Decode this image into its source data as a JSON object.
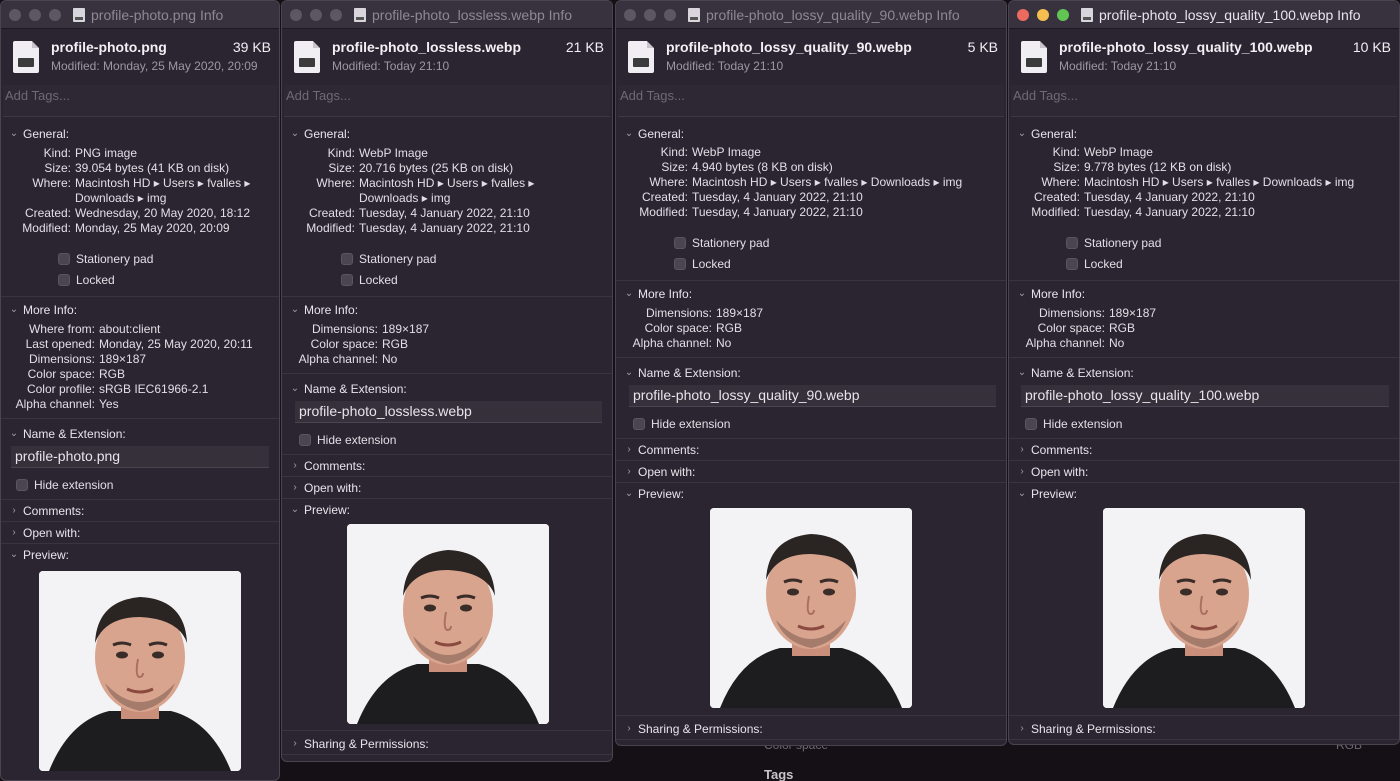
{
  "desktop": {
    "bg_text": "Color space",
    "bg_value": "RGB",
    "bg_label": "Tags"
  },
  "windows": [
    {
      "title": "profile-photo.png Info",
      "filename": "profile-photo.png",
      "size_short": "39 KB",
      "modified": "Modified: Monday, 25 May 2020, 20:09",
      "tags_placeholder": "Add Tags...",
      "general_label": "General:",
      "kind_key": "Kind:",
      "kind": "PNG image",
      "size_key": "Size:",
      "size": "39.054 bytes (41 KB on disk)",
      "where_key": "Where:",
      "where": "Macintosh HD ▸ Users ▸ fvalles ▸",
      "where2": "Downloads ▸ img",
      "created_key": "Created:",
      "created": "Wednesday, 20 May 2020, 18:12",
      "modified_key": "Modified:",
      "modified_val": "Monday, 25 May 2020, 20:09",
      "stationery": "Stationery pad",
      "locked": "Locked",
      "more_info_label": "More Info:",
      "more_info": [
        {
          "k": "Where from:",
          "v": "about:client"
        },
        {
          "k": "Last opened:",
          "v": "Monday, 25 May 2020, 20:11"
        },
        {
          "k": "Dimensions:",
          "v": "189×187"
        },
        {
          "k": "Color space:",
          "v": "RGB"
        },
        {
          "k": "Color profile:",
          "v": "sRGB IEC61966-2.1"
        },
        {
          "k": "Alpha channel:",
          "v": "Yes"
        }
      ],
      "name_ext_label": "Name & Extension:",
      "name_value": "profile-photo.png",
      "hide_ext": "Hide extension",
      "comments_label": "Comments:",
      "open_with_label": "Open with:",
      "preview_label": "Preview:"
    },
    {
      "title": "profile-photo_lossless.webp Info",
      "filename": "profile-photo_lossless.webp",
      "size_short": "21 KB",
      "modified": "Modified: Today 21:10",
      "tags_placeholder": "Add Tags...",
      "general_label": "General:",
      "kind_key": "Kind:",
      "kind": "WebP Image",
      "size_key": "Size:",
      "size": "20.716 bytes (25 KB on disk)",
      "where_key": "Where:",
      "where": "Macintosh HD ▸ Users ▸ fvalles ▸",
      "where2": "Downloads ▸ img",
      "created_key": "Created:",
      "created": "Tuesday, 4 January 2022, 21:10",
      "modified_key": "Modified:",
      "modified_val": "Tuesday, 4 January 2022, 21:10",
      "stationery": "Stationery pad",
      "locked": "Locked",
      "more_info_label": "More Info:",
      "more_info": [
        {
          "k": "Dimensions:",
          "v": "189×187"
        },
        {
          "k": "Color space:",
          "v": "RGB"
        },
        {
          "k": "Alpha channel:",
          "v": "No"
        }
      ],
      "name_ext_label": "Name & Extension:",
      "name_value": "profile-photo_lossless.webp",
      "hide_ext": "Hide extension",
      "comments_label": "Comments:",
      "open_with_label": "Open with:",
      "preview_label": "Preview:",
      "sharing_label": "Sharing & Permissions:"
    },
    {
      "title": "profile-photo_lossy_quality_90.webp Info",
      "filename": "profile-photo_lossy_quality_90.webp",
      "size_short": "5 KB",
      "modified": "Modified: Today 21:10",
      "tags_placeholder": "Add Tags...",
      "general_label": "General:",
      "kind_key": "Kind:",
      "kind": "WebP Image",
      "size_key": "Size:",
      "size": "4.940 bytes (8 KB on disk)",
      "where_key": "Where:",
      "where": "Macintosh HD ▸ Users ▸ fvalles ▸ Downloads ▸ img",
      "created_key": "Created:",
      "created": "Tuesday, 4 January 2022, 21:10",
      "modified_key": "Modified:",
      "modified_val": "Tuesday, 4 January 2022, 21:10",
      "stationery": "Stationery pad",
      "locked": "Locked",
      "more_info_label": "More Info:",
      "more_info": [
        {
          "k": "Dimensions:",
          "v": "189×187"
        },
        {
          "k": "Color space:",
          "v": "RGB"
        },
        {
          "k": "Alpha channel:",
          "v": "No"
        }
      ],
      "name_ext_label": "Name & Extension:",
      "name_value": "profile-photo_lossy_quality_90.webp",
      "hide_ext": "Hide extension",
      "comments_label": "Comments:",
      "open_with_label": "Open with:",
      "preview_label": "Preview:",
      "sharing_label": "Sharing & Permissions:"
    },
    {
      "title": "profile-photo_lossy_quality_100.webp Info",
      "filename": "profile-photo_lossy_quality_100.webp",
      "size_short": "10 KB",
      "modified": "Modified: Today 21:10",
      "tags_placeholder": "Add Tags...",
      "general_label": "General:",
      "kind_key": "Kind:",
      "kind": "WebP Image",
      "size_key": "Size:",
      "size": "9.778 bytes (12 KB on disk)",
      "where_key": "Where:",
      "where": "Macintosh HD ▸ Users ▸ fvalles ▸ Downloads ▸ img",
      "created_key": "Created:",
      "created": "Tuesday, 4 January 2022, 21:10",
      "modified_key": "Modified:",
      "modified_val": "Tuesday, 4 January 2022, 21:10",
      "stationery": "Stationery pad",
      "locked": "Locked",
      "more_info_label": "More Info:",
      "more_info": [
        {
          "k": "Dimensions:",
          "v": "189×187"
        },
        {
          "k": "Color space:",
          "v": "RGB"
        },
        {
          "k": "Alpha channel:",
          "v": "No"
        }
      ],
      "name_ext_label": "Name & Extension:",
      "name_value": "profile-photo_lossy_quality_100.webp",
      "hide_ext": "Hide extension",
      "comments_label": "Comments:",
      "open_with_label": "Open with:",
      "preview_label": "Preview:",
      "sharing_label": "Sharing & Permissions:"
    }
  ]
}
